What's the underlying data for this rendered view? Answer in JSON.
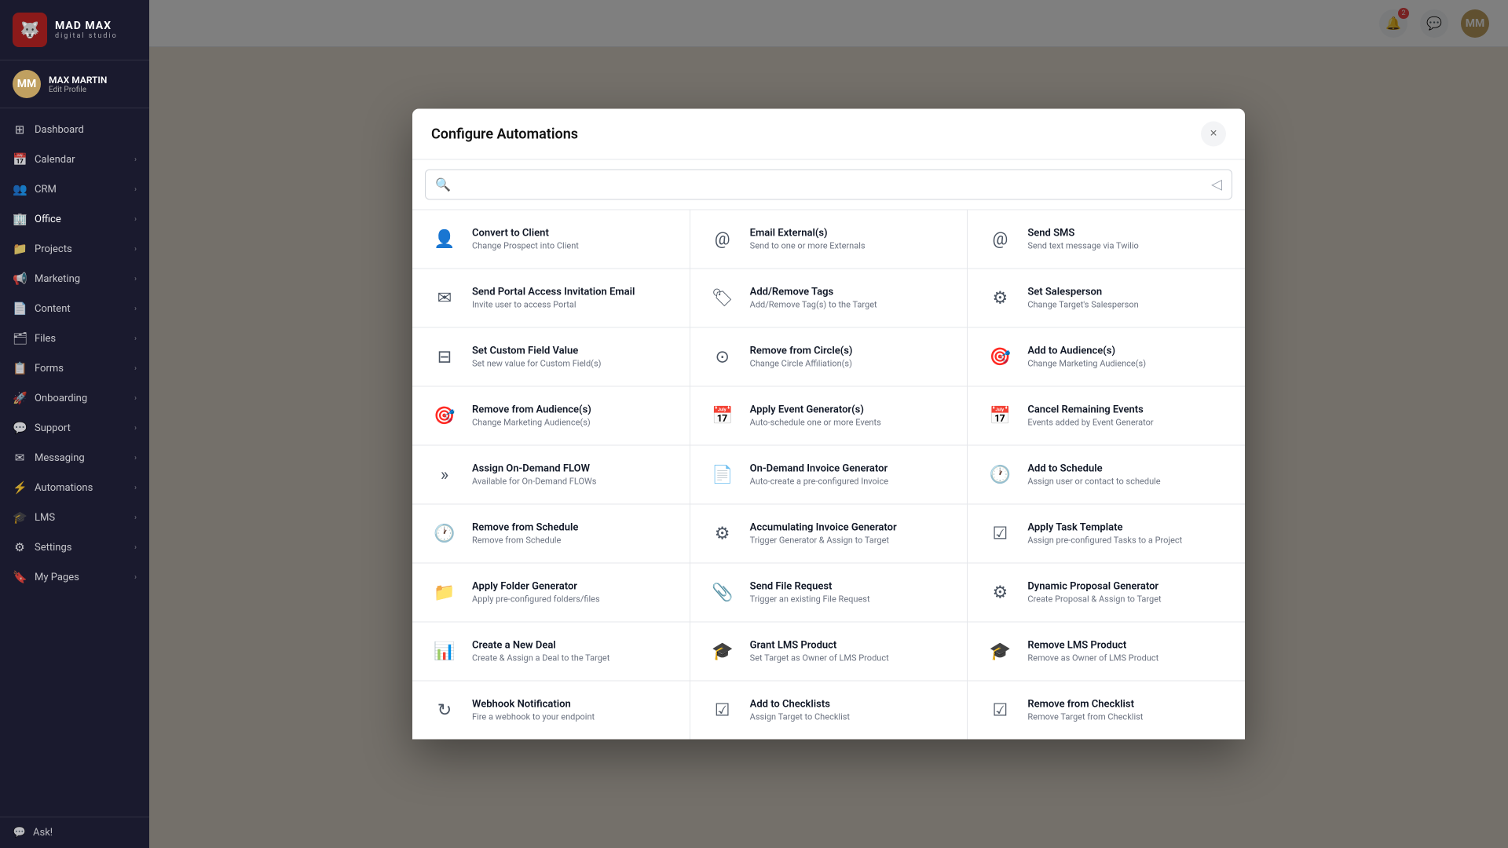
{
  "app": {
    "brand": "MAD MAX",
    "sub": "digital studio"
  },
  "user": {
    "name": "MAX MARTIN",
    "edit_label": "Edit Profile",
    "initials": "MM"
  },
  "sidebar": {
    "items": [
      {
        "id": "dashboard",
        "label": "Dashboard",
        "icon": "⊞",
        "has_chevron": false
      },
      {
        "id": "calendar",
        "label": "Calendar",
        "icon": "📅",
        "has_chevron": true
      },
      {
        "id": "crm",
        "label": "CRM",
        "icon": "👥",
        "has_chevron": true
      },
      {
        "id": "office",
        "label": "Office",
        "icon": "🏢",
        "has_chevron": true,
        "active": true
      },
      {
        "id": "projects",
        "label": "Projects",
        "icon": "📁",
        "has_chevron": true
      },
      {
        "id": "marketing",
        "label": "Marketing",
        "icon": "📢",
        "has_chevron": true
      },
      {
        "id": "content",
        "label": "Content",
        "icon": "📄",
        "has_chevron": true
      },
      {
        "id": "files",
        "label": "Files",
        "icon": "🗂",
        "has_chevron": true
      },
      {
        "id": "forms",
        "label": "Forms",
        "icon": "📋",
        "has_chevron": true
      },
      {
        "id": "onboarding",
        "label": "Onboarding",
        "icon": "🚀",
        "has_chevron": true
      },
      {
        "id": "support",
        "label": "Support",
        "icon": "💬",
        "has_chevron": true
      },
      {
        "id": "messaging",
        "label": "Messaging",
        "icon": "✉",
        "has_chevron": true
      },
      {
        "id": "automations",
        "label": "Automations",
        "icon": "⚡",
        "has_chevron": true
      },
      {
        "id": "lms",
        "label": "LMS",
        "icon": "🎓",
        "has_chevron": true
      },
      {
        "id": "settings",
        "label": "Settings",
        "icon": "⚙",
        "has_chevron": true
      },
      {
        "id": "mypages",
        "label": "My Pages",
        "icon": "🔖",
        "has_chevron": true
      }
    ],
    "ask_label": "Ask!"
  },
  "modal": {
    "title": "Configure Automations",
    "search_placeholder": "",
    "close_label": "×",
    "cards": [
      {
        "id": "convert-to-client",
        "title": "Convert to Client",
        "desc": "Change Prospect into Client",
        "icon": "👤"
      },
      {
        "id": "email-externals",
        "title": "Email External(s)",
        "desc": "Send to one or more Externals",
        "icon": "@"
      },
      {
        "id": "send-sms",
        "title": "Send SMS",
        "desc": "Send text message via Twilio",
        "icon": "@"
      },
      {
        "id": "send-portal-access",
        "title": "Send Portal Access Invitation Email",
        "desc": "Invite user to access Portal",
        "icon": "✉"
      },
      {
        "id": "add-remove-tags",
        "title": "Add/Remove Tags",
        "desc": "Add/Remove Tag(s) to the Target",
        "icon": "🏷"
      },
      {
        "id": "set-salesperson",
        "title": "Set Salesperson",
        "desc": "Change Target's Salesperson",
        "icon": "⚙"
      },
      {
        "id": "set-custom-field",
        "title": "Set Custom Field Value",
        "desc": "Set new value for Custom Field(s)",
        "icon": "⊟"
      },
      {
        "id": "remove-from-circle",
        "title": "Remove from Circle(s)",
        "desc": "Change Circle Affiliation(s)",
        "icon": "⊙"
      },
      {
        "id": "add-to-audiences",
        "title": "Add to Audience(s)",
        "desc": "Change Marketing Audience(s)",
        "icon": "🎯"
      },
      {
        "id": "remove-from-audiences",
        "title": "Remove from Audience(s)",
        "desc": "Change Marketing Audience(s)",
        "icon": "🎯"
      },
      {
        "id": "apply-event-generator",
        "title": "Apply Event Generator(s)",
        "desc": "Auto-schedule one or more Events",
        "icon": "📅"
      },
      {
        "id": "cancel-remaining-events",
        "title": "Cancel Remaining Events",
        "desc": "Events added by Event Generator",
        "icon": "📅"
      },
      {
        "id": "assign-on-demand-flow",
        "title": "Assign On-Demand FLOW",
        "desc": "Available for On-Demand FLOWs",
        "icon": "»"
      },
      {
        "id": "on-demand-invoice-generator",
        "title": "On-Demand Invoice Generator",
        "desc": "Auto-create a pre-configured Invoice",
        "icon": "📄"
      },
      {
        "id": "add-to-schedule",
        "title": "Add to Schedule",
        "desc": "Assign user or contact to schedule",
        "icon": "🕐"
      },
      {
        "id": "remove-from-schedule",
        "title": "Remove from Schedule",
        "desc": "Remove from Schedule",
        "icon": "🕐"
      },
      {
        "id": "accumulating-invoice-generator",
        "title": "Accumulating Invoice Generator",
        "desc": "Trigger Generator & Assign to Target",
        "icon": "⚙"
      },
      {
        "id": "apply-task-template",
        "title": "Apply Task Template",
        "desc": "Assign pre-configured Tasks to a Project",
        "icon": "☑"
      },
      {
        "id": "apply-folder-generator",
        "title": "Apply Folder Generator",
        "desc": "Apply pre-configured folders/files",
        "icon": "📁"
      },
      {
        "id": "send-file-request",
        "title": "Send File Request",
        "desc": "Trigger an existing File Request",
        "icon": "📎"
      },
      {
        "id": "dynamic-proposal-generator",
        "title": "Dynamic Proposal Generator",
        "desc": "Create Proposal & Assign to Target",
        "icon": "⚙"
      },
      {
        "id": "create-new-deal",
        "title": "Create a New Deal",
        "desc": "Create & Assign a Deal to the Target",
        "icon": "📊"
      },
      {
        "id": "grant-lms-product",
        "title": "Grant LMS Product",
        "desc": "Set Target as Owner of LMS Product",
        "icon": "🎓"
      },
      {
        "id": "remove-lms-product",
        "title": "Remove LMS Product",
        "desc": "Remove as Owner of LMS Product",
        "icon": "🎓"
      },
      {
        "id": "webhook-notification",
        "title": "Webhook Notification",
        "desc": "Fire a webhook to your endpoint",
        "icon": "↻"
      },
      {
        "id": "add-to-checklists",
        "title": "Add to Checklists",
        "desc": "Assign Target to Checklist",
        "icon": "☑"
      },
      {
        "id": "remove-from-checklist",
        "title": "Remove from Checklist",
        "desc": "Remove Target from Checklist",
        "icon": "☑"
      }
    ]
  },
  "topbar": {
    "notification_count": "2",
    "user_initials": "MM"
  }
}
